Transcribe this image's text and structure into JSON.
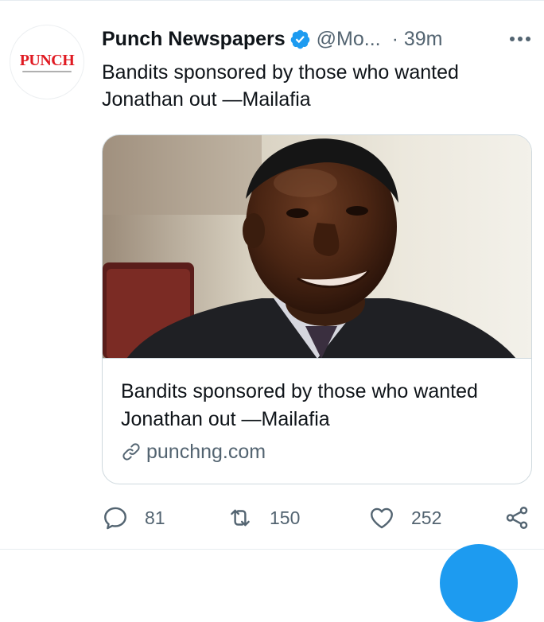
{
  "tweet": {
    "author_name": "Punch Newspapers",
    "handle": "@Mo...",
    "time": "· 39m",
    "text": "Bandits sponsored by those who wanted Jonathan out —Mailafia",
    "avatar_logo": "PUNCH",
    "verified": true
  },
  "card": {
    "title": "Bandits sponsored by those who wanted Jonathan out —Mailafia",
    "domain": "punchng.com",
    "link_icon": "link-icon"
  },
  "actions": {
    "replies": "81",
    "retweets": "150",
    "likes": "252"
  },
  "icons": {
    "more": "more-icon",
    "reply": "reply-icon",
    "retweet": "retweet-icon",
    "like": "heart-icon",
    "share": "share-icon",
    "verified": "verified-badge-icon"
  },
  "colors": {
    "accent": "#1d9bf0",
    "text_primary": "#0f1419",
    "text_secondary": "#536471",
    "brand_red": "#e01a22",
    "border": "#cfd9de"
  }
}
